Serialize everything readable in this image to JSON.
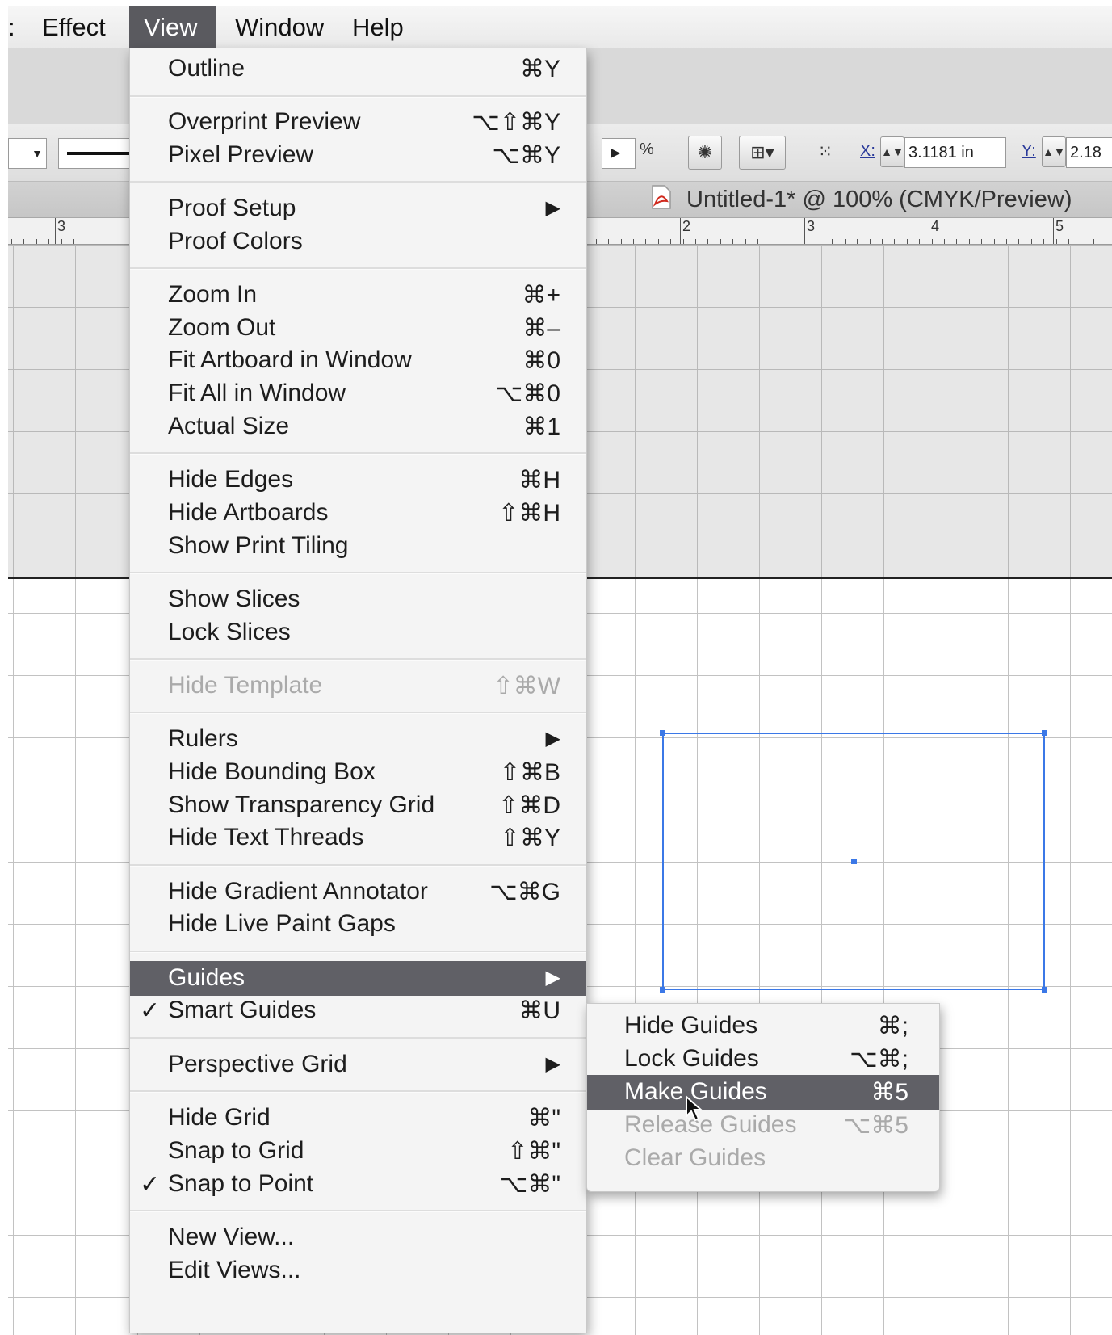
{
  "menubar": {
    "items": [
      {
        "label": ":",
        "active": false
      },
      {
        "label": "Effect",
        "active": false
      },
      {
        "label": "View",
        "active": true
      },
      {
        "label": "Window",
        "active": false
      },
      {
        "label": "Help",
        "active": false
      }
    ]
  },
  "control_bar": {
    "percent_label": "%",
    "x_label": "X:",
    "x_value": "3.1181 in",
    "y_label": "Y:",
    "y_value": "2.18"
  },
  "document": {
    "title": "Untitled-1* @ 100% (CMYK/Preview)"
  },
  "ruler": {
    "left_numbers": [
      "3"
    ],
    "numbers": [
      "2",
      "3",
      "4",
      "5"
    ]
  },
  "view_menu": {
    "items": [
      {
        "label": "Outline",
        "shortcut": "⌘Y"
      },
      {
        "label": "Overprint Preview",
        "shortcut": "⌥⇧⌘Y"
      },
      {
        "label": "Pixel Preview",
        "shortcut": "⌥⌘Y"
      },
      {
        "label": "Proof Setup",
        "submenu": true
      },
      {
        "label": "Proof Colors",
        "shortcut": ""
      },
      {
        "label": "Zoom In",
        "shortcut": "⌘+"
      },
      {
        "label": "Zoom Out",
        "shortcut": "⌘–"
      },
      {
        "label": "Fit Artboard in Window",
        "shortcut": "⌘0"
      },
      {
        "label": "Fit All in Window",
        "shortcut": "⌥⌘0"
      },
      {
        "label": "Actual Size",
        "shortcut": "⌘1"
      },
      {
        "label": "Hide Edges",
        "shortcut": "⌘H"
      },
      {
        "label": "Hide Artboards",
        "shortcut": "⇧⌘H"
      },
      {
        "label": "Show Print Tiling",
        "shortcut": ""
      },
      {
        "label": "Show Slices",
        "shortcut": ""
      },
      {
        "label": "Lock Slices",
        "shortcut": ""
      },
      {
        "label": "Hide Template",
        "shortcut": "⇧⌘W",
        "disabled": true
      },
      {
        "label": "Rulers",
        "submenu": true
      },
      {
        "label": "Hide Bounding Box",
        "shortcut": "⇧⌘B"
      },
      {
        "label": "Show Transparency Grid",
        "shortcut": "⇧⌘D"
      },
      {
        "label": "Hide Text Threads",
        "shortcut": "⇧⌘Y"
      },
      {
        "label": "Hide Gradient Annotator",
        "shortcut": "⌥⌘G"
      },
      {
        "label": "Hide Live Paint Gaps",
        "shortcut": ""
      },
      {
        "label": "Guides",
        "submenu": true,
        "highlighted": true
      },
      {
        "label": "Smart Guides",
        "shortcut": "⌘U",
        "checked": true
      },
      {
        "label": "Perspective Grid",
        "submenu": true
      },
      {
        "label": "Hide Grid",
        "shortcut": "⌘\""
      },
      {
        "label": "Snap to Grid",
        "shortcut": "⇧⌘\""
      },
      {
        "label": "Snap to Point",
        "shortcut": "⌥⌘\"",
        "checked": true
      },
      {
        "label": "New View...",
        "shortcut": ""
      },
      {
        "label": "Edit Views...",
        "shortcut": ""
      }
    ],
    "submenu_arrow": "▶",
    "check_mark": "✓"
  },
  "guides_submenu": {
    "items": [
      {
        "label": "Hide Guides",
        "shortcut": "⌘;"
      },
      {
        "label": "Lock Guides",
        "shortcut": "⌥⌘;"
      },
      {
        "label": "Make Guides",
        "shortcut": "⌘5",
        "highlighted": true
      },
      {
        "label": "Release Guides",
        "shortcut": "⌥⌘5",
        "disabled": true
      },
      {
        "label": "Clear Guides",
        "shortcut": "",
        "disabled": true
      }
    ]
  },
  "colors": {
    "menu_highlight": "#606066",
    "selection": "#3b78e7"
  }
}
